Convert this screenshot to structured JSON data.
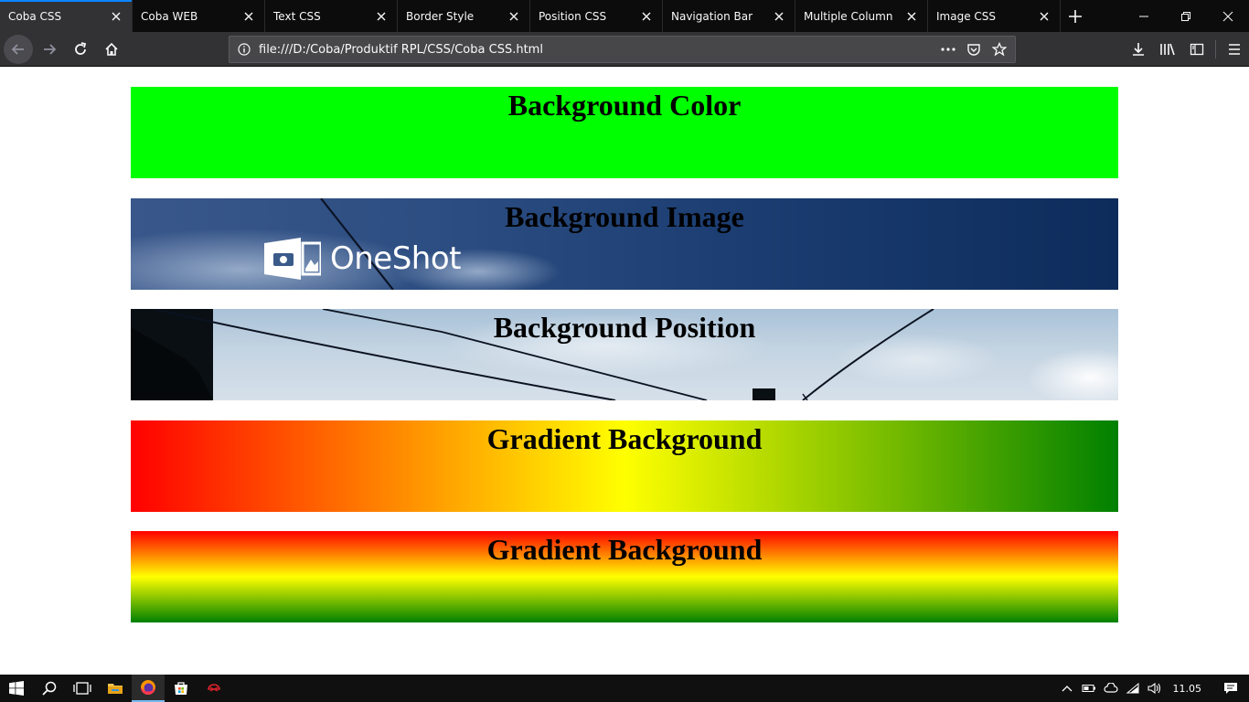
{
  "browser": {
    "tabs": [
      {
        "label": "Coba CSS",
        "active": true
      },
      {
        "label": "Coba WEB",
        "active": false
      },
      {
        "label": "Text CSS",
        "active": false
      },
      {
        "label": "Border Style",
        "active": false
      },
      {
        "label": "Position CSS",
        "active": false
      },
      {
        "label": "Navigation Bar",
        "active": false
      },
      {
        "label": "Multiple Column",
        "active": false
      },
      {
        "label": "Image CSS",
        "active": false
      }
    ],
    "url": "file:///D:/Coba/Produktif RPL/CSS/Coba CSS.html",
    "accent_color": "#0a84ff"
  },
  "page": {
    "sections": [
      {
        "heading": "Background Color",
        "bg_color": "#00ff00"
      },
      {
        "heading": "Background Image"
      },
      {
        "heading": "Background Position"
      },
      {
        "heading": "Gradient Background",
        "gradient_colors": [
          "#ff0000",
          "#ffff00",
          "#008000"
        ],
        "direction": "horizontal"
      },
      {
        "heading": "Gradient Background",
        "gradient_colors": [
          "#ff0000",
          "#ffff00",
          "#008000"
        ],
        "direction": "vertical"
      }
    ],
    "watermark": "OneShot"
  },
  "taskbar": {
    "clock": "11.05",
    "pinned": [
      "start-icon",
      "search-icon",
      "task-view-icon",
      "file-explorer-icon",
      "firefox-icon",
      "store-icon",
      "app-icon"
    ]
  }
}
